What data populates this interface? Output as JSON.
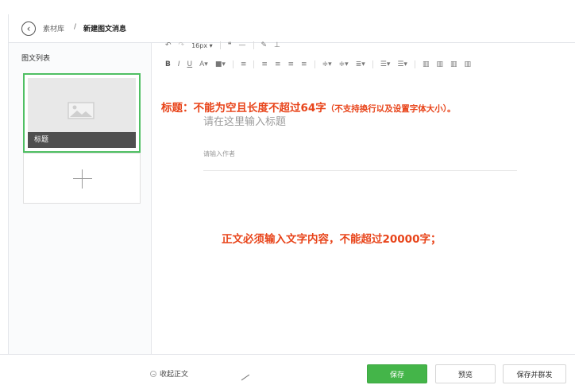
{
  "breadcrumb": {
    "library": "素材库",
    "separator": "/",
    "current": "新建图文消息"
  },
  "sidebar": {
    "title": "图文列表",
    "articles": [
      {
        "caption": "标题"
      }
    ]
  },
  "toolbar": {
    "row1": [
      {
        "label": "↶",
        "icon": "undo-icon",
        "enabled": true
      },
      {
        "label": "↷",
        "icon": "redo-icon",
        "enabled": false
      },
      {
        "label": "16px ▾",
        "icon": "font-size-select",
        "enabled": true
      },
      {
        "label": "❝",
        "icon": "quote-icon",
        "enabled": true
      },
      {
        "label": "—",
        "icon": "horizontal-rule-icon",
        "enabled": true
      },
      {
        "label": "✎",
        "icon": "format-brush-icon",
        "enabled": true
      },
      {
        "label": "⊥",
        "icon": "clear-format-icon",
        "enabled": true
      }
    ],
    "row2": [
      {
        "label": "B",
        "icon": "bold-icon"
      },
      {
        "label": "I",
        "icon": "italic-icon"
      },
      {
        "label": "U",
        "icon": "underline-icon"
      },
      {
        "label": "A▾",
        "icon": "font-color-icon"
      },
      {
        "label": "■▾",
        "icon": "background-color-icon"
      },
      {
        "label": "≡",
        "icon": "indent-icon"
      },
      {
        "label": "≡",
        "icon": "align-left-icon"
      },
      {
        "label": "≡",
        "icon": "align-center-icon"
      },
      {
        "label": "≡",
        "icon": "align-right-icon"
      },
      {
        "label": "≡",
        "icon": "justify-icon"
      },
      {
        "label": "≑▾",
        "icon": "spacing-before-icon"
      },
      {
        "label": "≑▾",
        "icon": "spacing-after-icon"
      },
      {
        "label": "≣▾",
        "icon": "line-height-icon"
      },
      {
        "label": "☰▾",
        "icon": "ordered-list-icon"
      },
      {
        "label": "☰▾",
        "icon": "unordered-list-icon"
      },
      {
        "label": "▥",
        "icon": "float-none-icon"
      },
      {
        "label": "▥",
        "icon": "float-left-icon"
      },
      {
        "label": "▥",
        "icon": "float-right-icon"
      },
      {
        "label": "▥",
        "icon": "float-center-icon"
      }
    ]
  },
  "editor": {
    "title_placeholder": "请在这里输入标题",
    "author_placeholder": "请输入作者"
  },
  "annotations": {
    "title_rule_main": "标题：不能为空且长度不超过64字",
    "title_rule_detail": "（不支持换行以及设置字体大小）。",
    "body_rule": "正文必须输入文字内容，不能超过20000字；"
  },
  "footer": {
    "collapse_label": "收起正文",
    "save_label": "保存",
    "preview_label": "预览",
    "save_send_label": "保存并群发"
  },
  "colors": {
    "accent_green": "#44b549",
    "annotation_red": "#e8441a"
  }
}
